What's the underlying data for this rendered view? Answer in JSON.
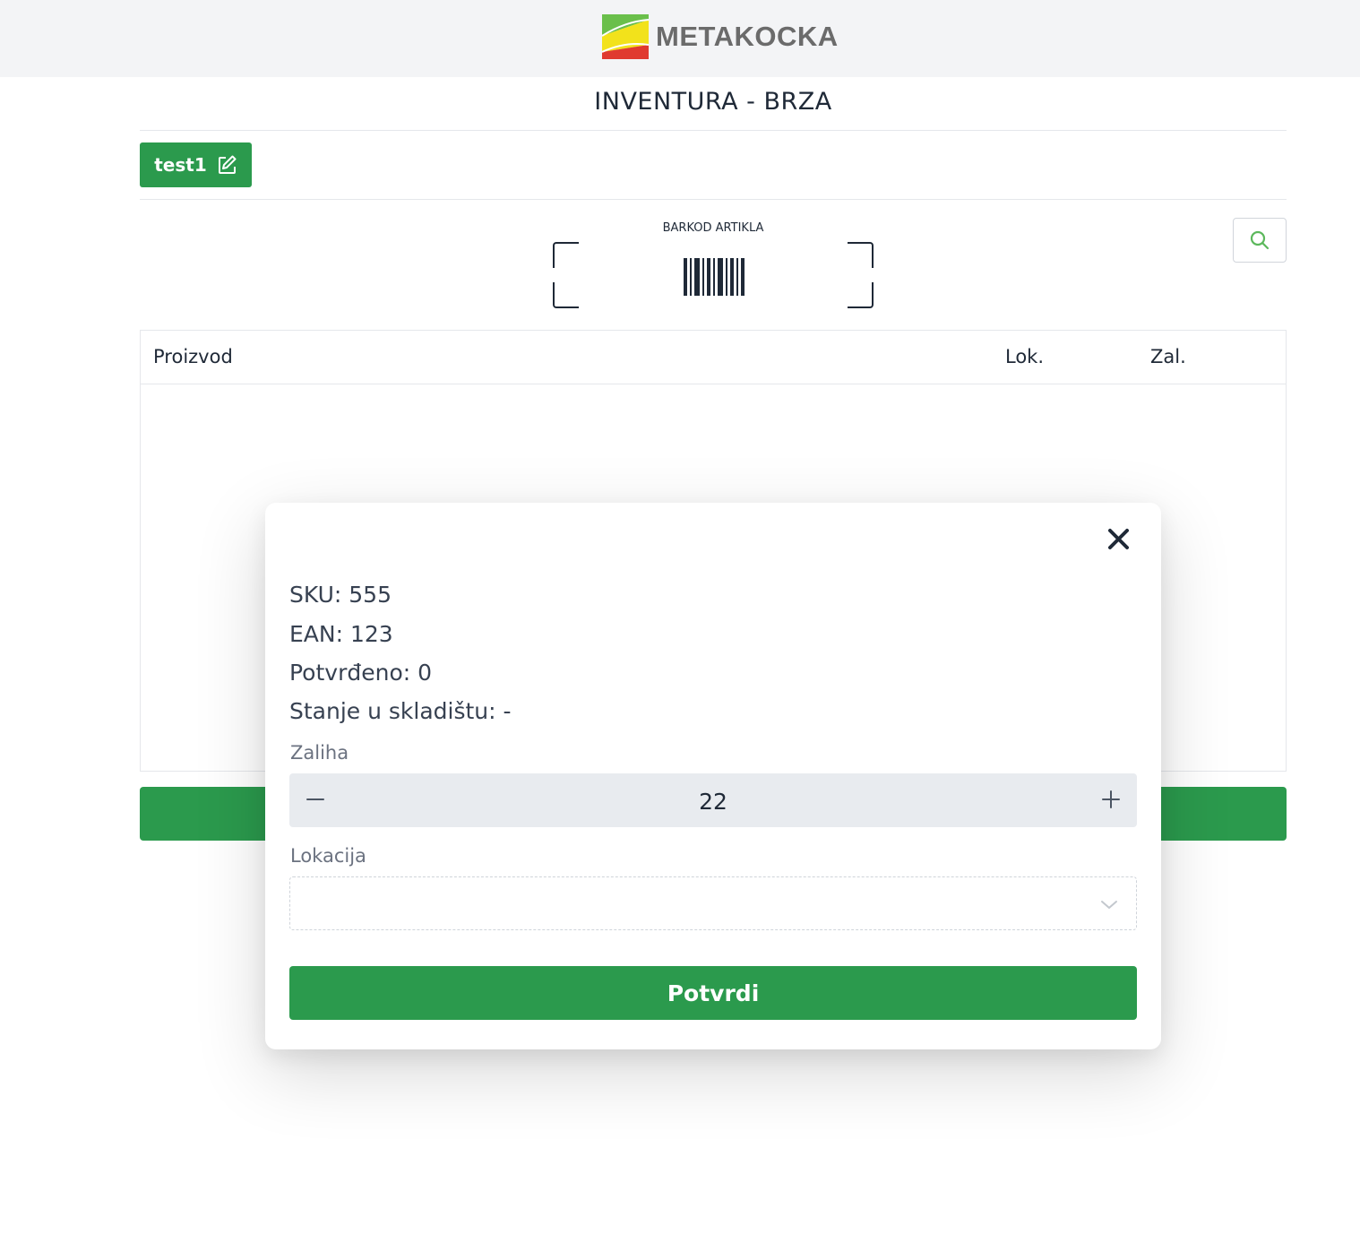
{
  "header": {
    "brand": "METAKOCKA",
    "logo_icon": "metakocka-logo"
  },
  "page": {
    "title": "INVENTURA - BRZA"
  },
  "session": {
    "label": "test1",
    "icon": "edit-icon"
  },
  "scanner": {
    "label": "BARKOD ARTIKLA",
    "icon": "barcode-icon"
  },
  "search": {
    "icon": "search-icon"
  },
  "table": {
    "columns": [
      "Proizvod",
      "Lok.",
      "Zal."
    ],
    "rows": []
  },
  "modal": {
    "close_icon": "close-icon",
    "sku": "SKU: 555",
    "ean": "EAN: 123",
    "confirmed": "Potvrđeno: 0",
    "warehouse_stock": "Stanje u skladištu: -",
    "stock_label": "Zaliha",
    "stock_value": "22",
    "location_label": "Lokacija",
    "location_value": "",
    "confirm_label": "Potvrdi"
  },
  "colors": {
    "accent": "#2b9a4d",
    "header_bg": "#f3f4f6",
    "stepper_bg": "#e8ebef",
    "search_icon": "#5cb85c"
  }
}
